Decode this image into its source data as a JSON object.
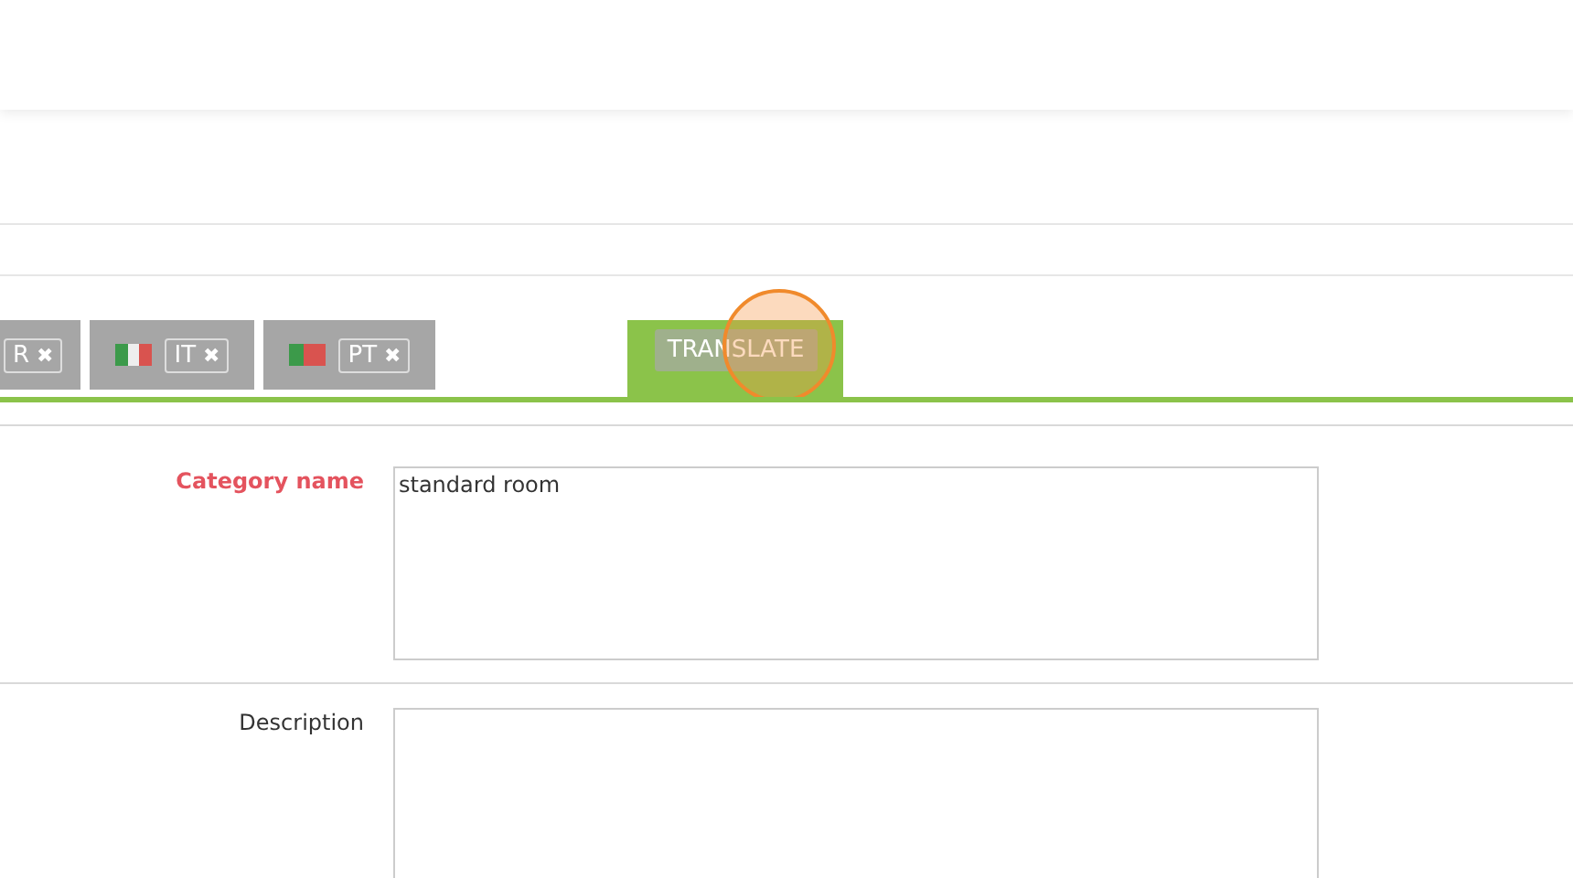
{
  "language_tabs": [
    {
      "code": "R",
      "selected": false
    },
    {
      "kind": "italy",
      "code": "IT",
      "selected": false
    },
    {
      "kind": "portugal",
      "code": "PT",
      "selected": false
    }
  ],
  "remove_glyph": "✖",
  "translate_button": {
    "label": "TRANSLATE",
    "clicked": true
  },
  "fields": [
    {
      "label": "Category name",
      "required": true,
      "value": "standard room"
    },
    {
      "label": "Description",
      "required": false
    }
  ]
}
